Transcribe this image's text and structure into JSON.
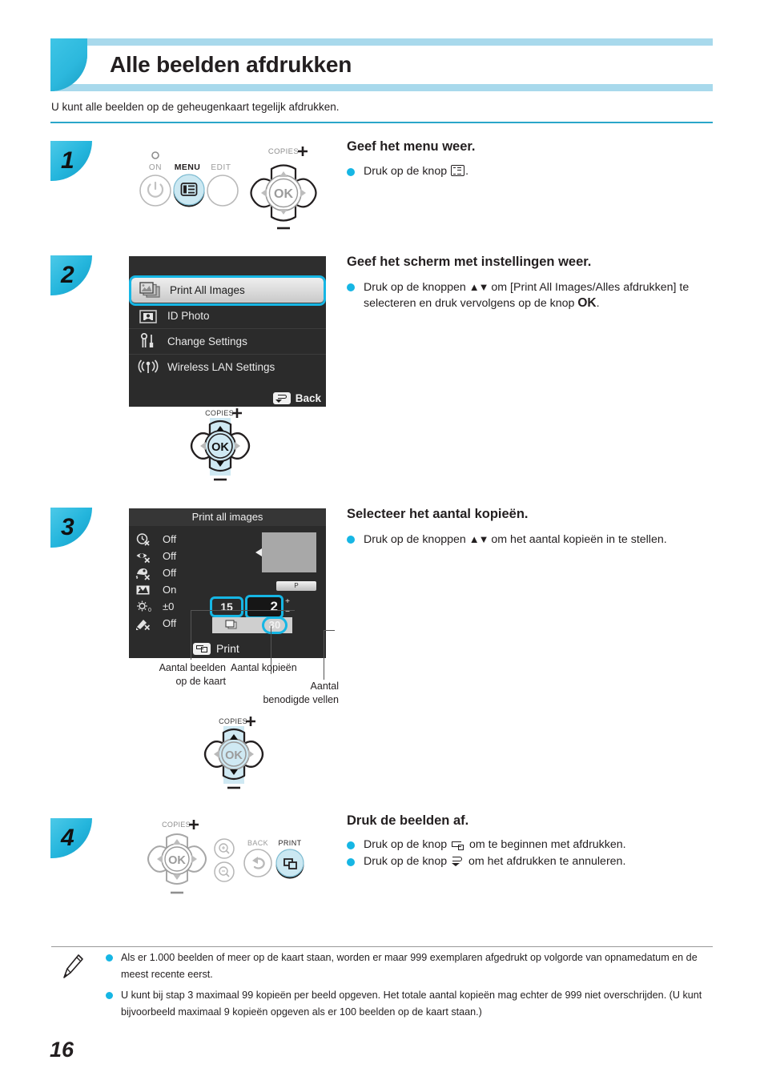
{
  "page": {
    "title": "Alle beelden afdrukken",
    "intro": "U kunt alle beelden op de geheugenkaart tegelijk afdrukken.",
    "number": "16"
  },
  "steps": [
    {
      "badge": "1",
      "heading": "Geef het menu weer.",
      "bullets": [
        {
          "pre": "Druk op de knop ",
          "icon": "menu-icon",
          "post": "."
        }
      ],
      "controls": {
        "labels": [
          "ON",
          "MENU",
          "EDIT",
          "COPIES"
        ],
        "ok_label": "OK",
        "highlighted": "MENU"
      }
    },
    {
      "badge": "2",
      "heading": "Geef het scherm met instellingen weer.",
      "bullets": [
        {
          "pre": "Druk op de knoppen ",
          "arrows": "▲▼",
          "mid": " om [Print All Images/Alles afdrukken] te selecteren en druk vervolgens op de knop ",
          "bold": "OK",
          "post": "."
        }
      ],
      "menu_screen": {
        "items": [
          {
            "label": "Print All Images",
            "icon": "images-stack-icon",
            "selected": true
          },
          {
            "label": "ID Photo",
            "icon": "id-photo-icon",
            "selected": false
          },
          {
            "label": "Change Settings",
            "icon": "tools-icon",
            "selected": false
          },
          {
            "label": "Wireless LAN Settings",
            "icon": "wifi-icon",
            "selected": false
          }
        ],
        "back_label": "Back"
      },
      "controls": {
        "copies_label": "COPIES",
        "ok_label": "OK"
      }
    },
    {
      "badge": "3",
      "heading": "Selecteer het aantal kopieën.",
      "bullets": [
        {
          "pre": "Druk op de knoppen ",
          "arrows": "▲▼",
          "mid": " om het aantal kopieën in te stellen.",
          "post": ""
        }
      ],
      "print_screen": {
        "title": "Print all images",
        "settings": [
          {
            "icon": "date-off-icon",
            "value": "Off"
          },
          {
            "icon": "redeye-off-icon",
            "value": "Off"
          },
          {
            "icon": "effect-off-icon",
            "value": "Off"
          },
          {
            "icon": "image-optimize-icon",
            "value": "On"
          },
          {
            "icon": "brightness-icon",
            "value": "±0"
          },
          {
            "icon": "correction-off-icon",
            "value": "Off"
          }
        ],
        "paper_chip": "P",
        "image_count": "15",
        "copies": "2",
        "plus": "+",
        "minus": "−",
        "sheets": "30",
        "print_label": "Print"
      },
      "callouts": [
        {
          "name": "images-on-card",
          "line1": "Aantal beelden",
          "line2": "op de kaart"
        },
        {
          "name": "number-of-copies",
          "line1": "Aantal kopieën",
          "line2": ""
        },
        {
          "name": "sheets-needed",
          "line1": "Aantal",
          "line2": "benodigde vellen"
        }
      ],
      "controls": {
        "copies_label": "COPIES",
        "ok_label": "OK"
      }
    },
    {
      "badge": "4",
      "heading": "Druk de beelden af.",
      "bullets": [
        {
          "pre": "Druk op de knop ",
          "icon": "print-icon",
          "post": " om te beginnen met afdrukken."
        },
        {
          "pre": "Druk op de knop ",
          "icon": "back-icon",
          "post": " om het afdrukken te annuleren."
        }
      ],
      "controls": {
        "copies_label": "COPIES",
        "ok_label": "OK",
        "back_label": "BACK",
        "print_label": "PRINT",
        "zoom_in": "zoom-in-icon",
        "zoom_out": "zoom-out-icon"
      }
    }
  ],
  "notes": [
    "Als er 1.000 beelden of meer op de kaart staan, worden er maar 999 exemplaren afgedrukt op volgorde van opnamedatum en de meest recente eerst.",
    "U kunt bij stap 3 maximaal 99 kopieën per beeld opgeven. Het totale aantal kopieën mag echter de 999 niet overschrijden. (U kunt bijvoorbeeld maximaal 9 kopieën opgeven als er 100 beelden op de kaart staan.)"
  ],
  "colors": {
    "accent": "#16b6e4",
    "header_light": "#a8d9ec",
    "rule": "#2ba6c9"
  }
}
